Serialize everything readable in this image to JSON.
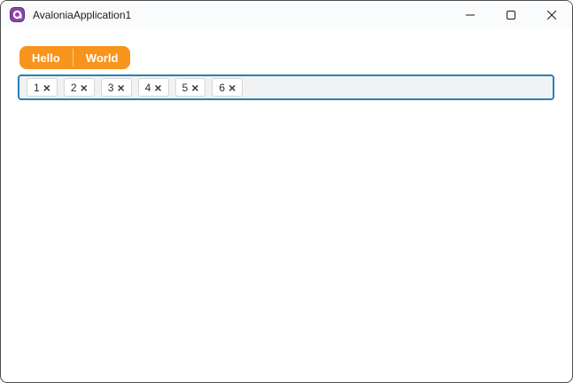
{
  "theme": {
    "accent_orange": "#F7941D",
    "orange_divider": "rgba(255,255,255,0.5)",
    "tag_border_blue": "#2B7FB5",
    "tagbox_bg": "#F0F2F4",
    "titlebar_bg": "#FAFBFC",
    "window_border": "#4C4C4C",
    "avalonia_purple": "#8B44AC"
  },
  "window": {
    "title": "AvaloniaApplication1",
    "icons": [
      "avalonia-logo-icon",
      "minimize-icon",
      "maximize-icon",
      "close-icon",
      "remove-tag-icon"
    ]
  },
  "toolbar": {
    "buttons": [
      {
        "label": "Hello"
      },
      {
        "label": "World"
      }
    ]
  },
  "tagbox": {
    "remove_glyph": "×",
    "chips": [
      {
        "value": "1"
      },
      {
        "value": "2"
      },
      {
        "value": "3"
      },
      {
        "value": "4"
      },
      {
        "value": "5"
      },
      {
        "value": "6"
      }
    ]
  }
}
